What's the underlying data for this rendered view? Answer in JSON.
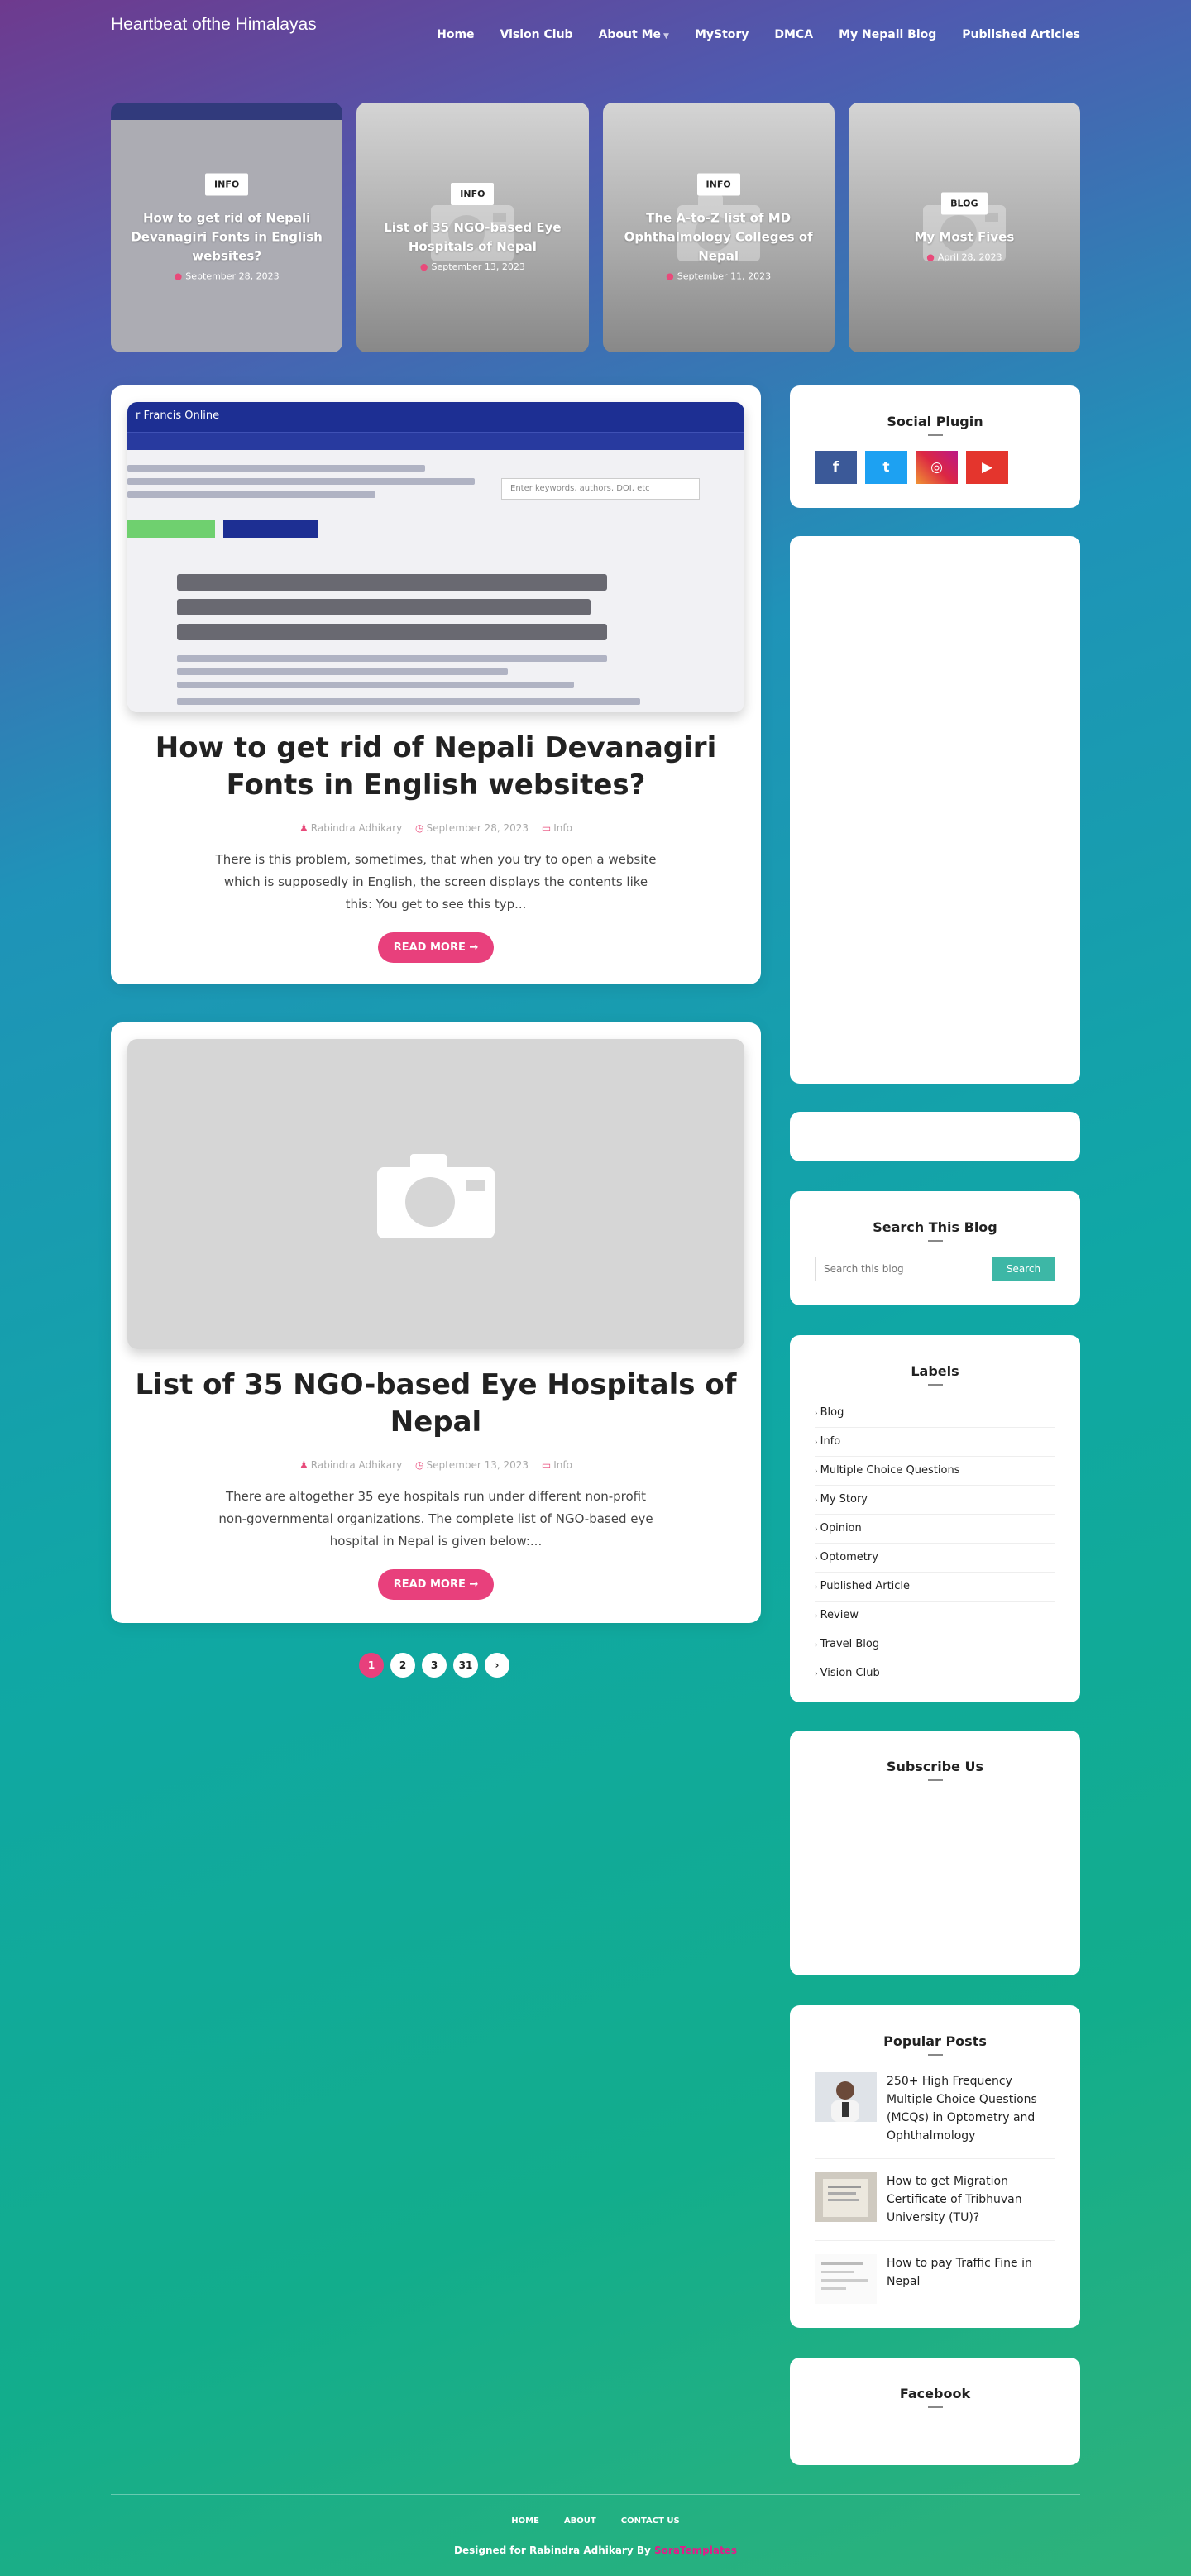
{
  "header": {
    "blog_title": "Heartbeat ofthe Himalayas",
    "nav": [
      "Home",
      "Vision Club",
      "About Me",
      "MyStory",
      "DMCA",
      "My Nepali Blog",
      "Published Articles"
    ]
  },
  "featured": [
    {
      "badge": "INFO",
      "title": "How to get rid of Nepali Devanagiri Fonts in English websites?",
      "date": "September 28, 2023"
    },
    {
      "badge": "INFO",
      "title": "List of 35 NGO-based Eye Hospitals of Nepal",
      "date": "September 13, 2023"
    },
    {
      "badge": "INFO",
      "title": "The A-to-Z list of MD Ophthalmology Colleges of Nepal",
      "date": "September 11, 2023"
    },
    {
      "badge": "BLOG",
      "title": "My Most Fives",
      "date": "April 28, 2023"
    }
  ],
  "posts": [
    {
      "title": "How to get rid of Nepali Devanagiri Fonts in English websites?",
      "author": "Rabindra Adhikary",
      "date": "September 28, 2023",
      "label": "Info",
      "snippet": "There is this problem, sometimes, that when you try to open a website which is supposedly in English, the screen displays the contents like this: You get to see this typ...",
      "read_more": "READ MORE",
      "screenshot": {
        "brand": "r Francis Online",
        "search_placeholder": "Enter keywords, authors, DOI, etc"
      }
    },
    {
      "title": "List of 35 NGO-based Eye Hospitals of Nepal",
      "author": "Rabindra Adhikary",
      "date": "September 13, 2023",
      "label": "Info",
      "snippet": "There are altogether 35 eye hospitals run under different non-profit non-governmental organizations. The complete list of NGO-based eye hospital in Nepal is given below:...",
      "read_more": "READ MORE"
    }
  ],
  "pagination": {
    "pages": [
      "1",
      "2",
      "3",
      "31"
    ],
    "active": "1"
  },
  "sidebar": {
    "social_title": "Social Plugin",
    "social": [
      {
        "icon": "facebook-icon",
        "glyph": "f",
        "color": "#3b5998"
      },
      {
        "icon": "twitter-icon",
        "glyph": "t",
        "color": "#1da1f2"
      },
      {
        "icon": "instagram-icon",
        "glyph": "◎",
        "color": "#c13584"
      },
      {
        "icon": "youtube-icon",
        "glyph": "▶",
        "color": "#e4352d"
      }
    ],
    "search_title": "Search This Blog",
    "search_placeholder": "Search this blog",
    "search_button": "Search",
    "labels_title": "Labels",
    "labels": [
      "Blog",
      "Info",
      "Multiple Choice Questions",
      "My Story",
      "Opinion",
      "Optometry",
      "Published Article",
      "Review",
      "Travel Blog",
      "Vision Club"
    ],
    "subscribe_title": "Subscribe Us",
    "popular_title": "Popular Posts",
    "popular": [
      "250+ High Frequency Multiple Choice Questions (MCQs) in Optometry and Ophthalmology",
      "How to get Migration Certificate of Tribhuvan University (TU)?",
      "How to pay Traffic Fine in Nepal"
    ],
    "facebook_title": "Facebook"
  },
  "footer": {
    "links": [
      "HOME",
      "ABOUT",
      "CONTACT US"
    ],
    "credit_prefix": "Designed for Rabindra Adhikary By",
    "credit_brand": "SoraTemplates"
  }
}
